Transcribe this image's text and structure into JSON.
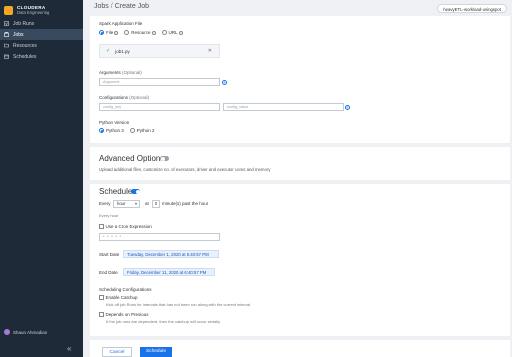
{
  "app": {
    "brand_name": "CLOUDERA",
    "brand_sub": "Data Engineering"
  },
  "sidebar": {
    "items": [
      {
        "label": "Job Runs"
      },
      {
        "label": "Jobs"
      },
      {
        "label": "Resources"
      },
      {
        "label": "Schedules"
      }
    ],
    "active_index": 1,
    "user_name": "Shaun Ahmadian",
    "collapse_glyph": "«"
  },
  "header": {
    "crumb_root": "Jobs",
    "crumb_sep": "/",
    "crumb_current": "Create Job",
    "cluster_chip": "heavyETL-workload-usingspot"
  },
  "spark_file": {
    "label": "Spark Application File",
    "options": [
      "File",
      "Resource",
      "URL"
    ],
    "selected": "File",
    "file_name": "job1.py"
  },
  "arguments": {
    "label": "Arguments",
    "optional": "(Optional)",
    "placeholder": "Argument"
  },
  "configurations": {
    "label": "Configurations",
    "optional": "(Optional)",
    "key_placeholder": "config_key",
    "value_placeholder": "config_value"
  },
  "python": {
    "label": "Python Version",
    "options": [
      "Python 3",
      "Python 2"
    ],
    "selected": "Python 3"
  },
  "advanced": {
    "title": "Advanced Options",
    "enabled": false,
    "description": "Upload additional files, customize no. of executors, driver and executor cores and memory"
  },
  "schedule": {
    "title": "Schedule",
    "enabled": true,
    "every_label": "Every",
    "every_value": "hour",
    "at_label": "at",
    "minute_value": "0",
    "minute_suffix": "minute(s) past the hour",
    "hint": "Every hour",
    "cron_label": "Use a Cron Expression",
    "cron_value": "* * * * *",
    "start_label": "Start Date",
    "start_value": "Tuesday, December 1, 2020 at 6:40:57 PM",
    "end_label": "End Date",
    "end_value": "Friday, December 11, 2020 at 6:40:57 PM",
    "sched_config_label": "Scheduling Configurations",
    "catchup_label": "Enable Catchup",
    "catchup_desc": "Kick off job Runs for intervals that has not been run along with the current interval",
    "depends_label": "Depends on Previous",
    "depends_desc": "If the job runs are dependent, then the catchup will occur serially"
  },
  "actions": {
    "cancel": "Cancel",
    "schedule": "Schedule"
  },
  "colors": {
    "accent": "#1a73e8",
    "sidebar_bg": "#1f2a38",
    "brand": "#f5a623"
  }
}
